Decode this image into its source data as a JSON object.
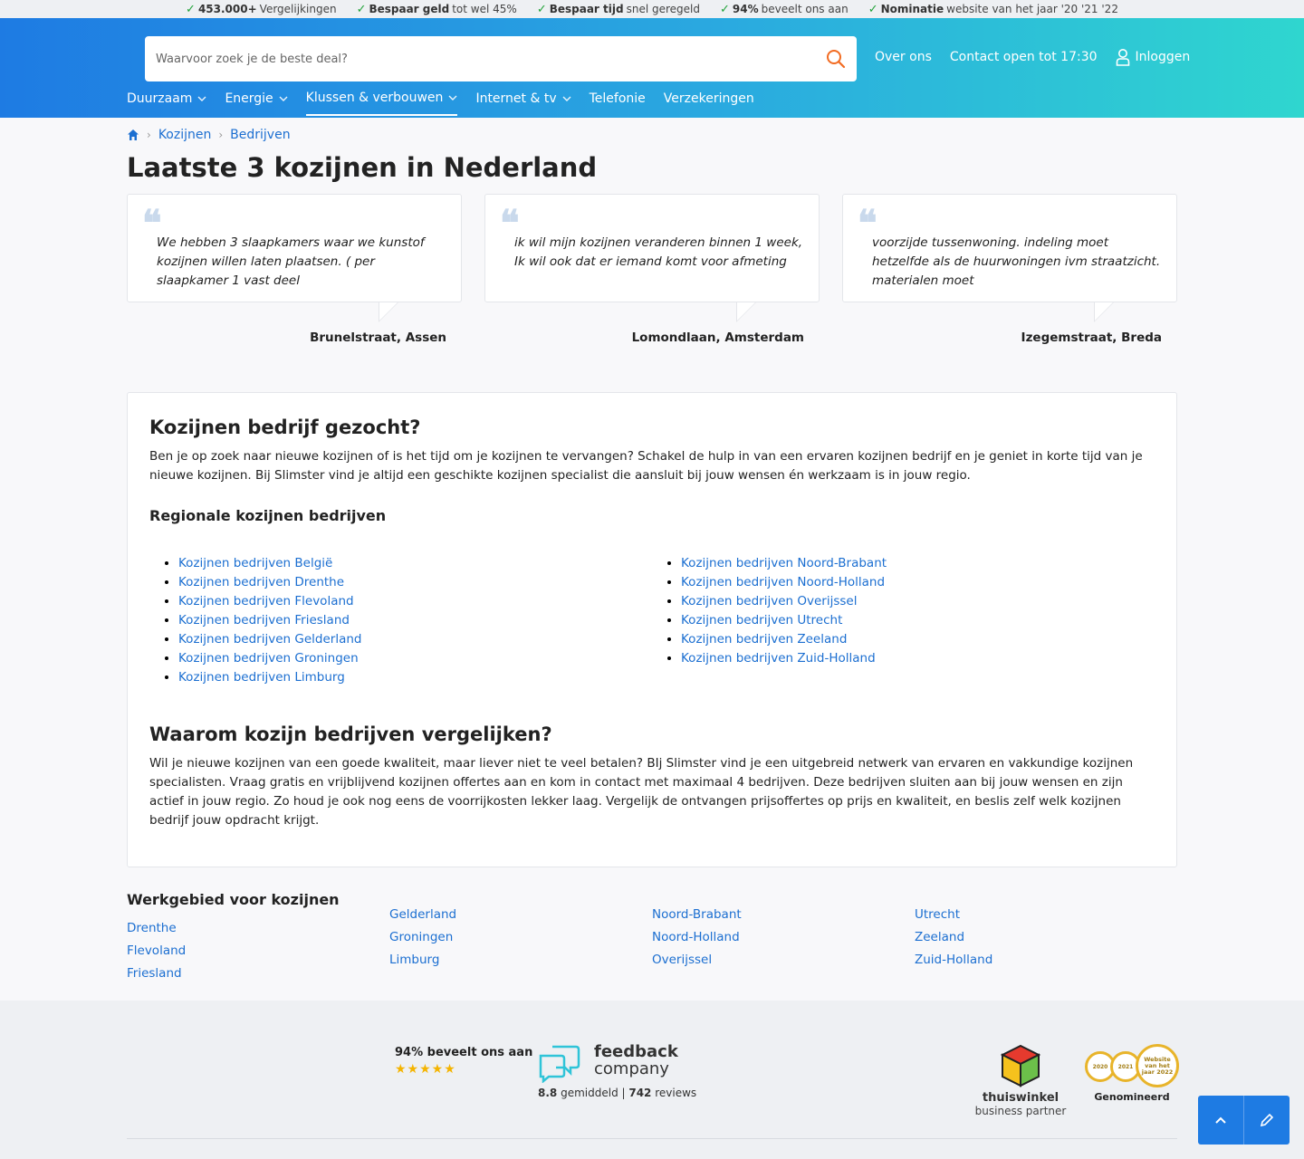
{
  "usp": [
    {
      "bold": "453.000+",
      "text": " Vergelijkingen"
    },
    {
      "bold": "Bespaar geld",
      "text": " tot wel 45%"
    },
    {
      "bold": "Bespaar tijd",
      "text": " snel geregeld"
    },
    {
      "bold": "94%",
      "text": " beveelt ons aan"
    },
    {
      "bold": "Nominatie",
      "text": " website van het jaar '20 '21 '22"
    }
  ],
  "header": {
    "search_placeholder": "Waarvoor zoek je de beste deal?",
    "links": {
      "about": "Over ons",
      "contact": "Contact open tot 17:30",
      "login": "Inloggen"
    },
    "nav": [
      {
        "label": "Duurzaam",
        "dropdown": true
      },
      {
        "label": "Energie",
        "dropdown": true
      },
      {
        "label": "Klussen & verbouwen",
        "dropdown": true,
        "active": true
      },
      {
        "label": "Internet & tv",
        "dropdown": true
      },
      {
        "label": "Telefonie",
        "dropdown": false
      },
      {
        "label": "Verzekeringen",
        "dropdown": false
      }
    ]
  },
  "breadcrumb": [
    "Kozijnen",
    "Bedrijven"
  ],
  "page_title": "Laatste 3 kozijnen in Nederland",
  "reviews": [
    {
      "text": "We hebben 3 slaapkamers waar we kunstof kozijnen willen laten plaatsen. ( per slaapkamer 1 vast deel",
      "author": "Brunelstraat, Assen"
    },
    {
      "text": "ik wil mijn kozijnen veranderen binnen 1 week, Ik wil ook dat er iemand komt voor afmeting",
      "author": "Lomondlaan, Amsterdam"
    },
    {
      "text": "voorzijde tussenwoning. indeling moet hetzelfde als de huurwoningen ivm straatzicht. materialen moet",
      "author": "Izegemstraat, Breda"
    }
  ],
  "info": {
    "h1": "Kozijnen bedrijf gezocht?",
    "p1": "Ben je op zoek naar nieuwe kozijnen of is het tijd om je kozijnen te vervangen? Schakel de hulp in van een ervaren kozijnen bedrijf en je geniet in korte tijd van je nieuwe kozijnen. Bij Slimster vind je altijd een geschikte kozijnen specialist die aansluit bij jouw wensen én werkzaam is in jouw regio.",
    "h3": "Regionale kozijnen bedrijven",
    "regions_left": [
      "Kozijnen bedrijven België",
      "Kozijnen bedrijven Drenthe",
      "Kozijnen bedrijven Flevoland",
      "Kozijnen bedrijven Friesland",
      "Kozijnen bedrijven Gelderland",
      "Kozijnen bedrijven Groningen",
      "Kozijnen bedrijven Limburg"
    ],
    "regions_right": [
      "Kozijnen bedrijven Noord-Brabant",
      "Kozijnen bedrijven Noord-Holland",
      "Kozijnen bedrijven Overijssel",
      "Kozijnen bedrijven Utrecht",
      "Kozijnen bedrijven Zeeland",
      "Kozijnen bedrijven Zuid-Holland"
    ],
    "h2": "Waarom kozijn bedrijven vergelijken?",
    "p2": "Wil je nieuwe kozijnen van een goede kwaliteit, maar liever niet te veel betalen? BIj Slimster vind je een uitgebreid netwerk van ervaren en vakkundige kozijnen specialisten. Vraag gratis en vrijblijvend kozijnen offertes aan en kom in contact met maximaal 4 bedrijven. Deze bedrijven sluiten aan bij jouw wensen en zijn actief in jouw regio. Zo houd je ook nog eens de voorrijkosten lekker laag. Vergelijk de ontvangen prijsoffertes op prijs en kwaliteit, en beslis zelf welk kozijnen bedrijf jouw opdracht krijgt."
  },
  "werkgebied": {
    "title": "Werkgebied voor kozijnen",
    "columns": [
      [
        "Drenthe",
        "Flevoland",
        "Friesland"
      ],
      [
        "Gelderland",
        "Groningen",
        "Limburg"
      ],
      [
        "Noord-Brabant",
        "Noord-Holland",
        "Overijssel"
      ],
      [
        "Utrecht",
        "Zeeland",
        "Zuid-Holland"
      ]
    ]
  },
  "footer": {
    "rating_text": "94% beveelt ons aan",
    "stars": "★★★★★",
    "feedback_word1": "feedback",
    "feedback_word2": "company",
    "avg": "8.8",
    "avg_label": "gemiddeld",
    "reviews_count": "742",
    "reviews_label": "reviews",
    "thuis1": "thuiswinkel",
    "thuis2": "business partner",
    "medals": [
      "2020",
      "2021",
      "Website van het jaar 2022"
    ],
    "award_label": "Genomineerd"
  },
  "colors": {
    "primary": "#1e7be3",
    "accent": "#2fd6cf",
    "link": "#1c6fd1",
    "search_icon": "#f26b21"
  }
}
